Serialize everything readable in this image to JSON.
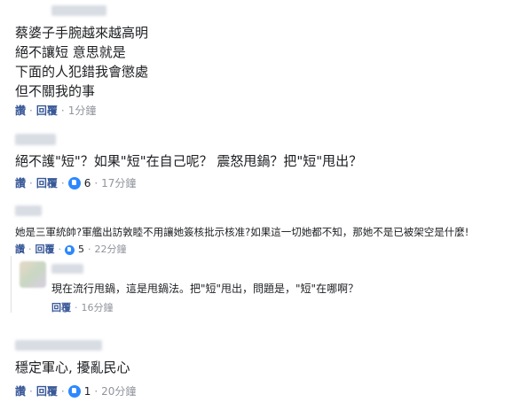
{
  "comments": [
    {
      "lines": [
        "蔡婆子手腕越來越高明",
        "絕不讓短 意思就是",
        "下面的人犯錯我會懲處",
        "但不關我的事"
      ],
      "actions": {
        "like": "讚",
        "reply": "回覆",
        "time": "1分鐘"
      }
    },
    {
      "text": "絕不護\"短\"？如果\"短\"在自己呢？ 震怒甩鍋？把\"短\"甩出？",
      "actions": {
        "like": "讚",
        "reply": "回覆",
        "reactions": "6",
        "time": "17分鐘"
      }
    },
    {
      "text": "她是三軍統帥?軍艦出訪敦睦不用讓她簽核批示核准?如果這一切她都不知，那她不是已被架空是什麼!",
      "actions": {
        "like": "讚",
        "reply": "回覆",
        "reactions": "5",
        "time": "22分鐘"
      },
      "reply": {
        "text": "現在流行甩鍋，這是甩鍋法。把\"短\"甩出，問題是，\"短\"在哪啊？",
        "actions": {
          "reply": "回覆",
          "time": "16分鐘"
        }
      }
    },
    {
      "text": "穩定軍心, 擾亂民心",
      "actions": {
        "like": "讚",
        "reply": "回覆",
        "reactions": "1",
        "time": "20分鐘"
      }
    }
  ],
  "colors": {
    "link": "#385898",
    "muted": "#90949c",
    "like": "#2d88ff"
  }
}
